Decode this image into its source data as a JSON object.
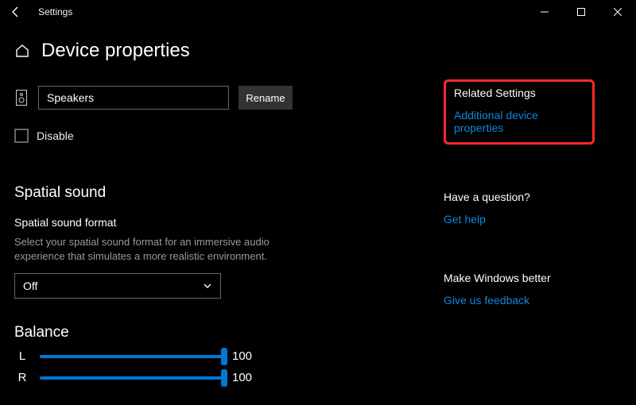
{
  "app": {
    "title": "Settings"
  },
  "page": {
    "title": "Device properties"
  },
  "device": {
    "name_value": "Speakers",
    "rename_label": "Rename"
  },
  "disable": {
    "label": "Disable"
  },
  "spatial": {
    "section": "Spatial sound",
    "format_label": "Spatial sound format",
    "help": "Select your spatial sound format for an immersive audio experience that simulates a more realistic environment.",
    "dropdown_value": "Off"
  },
  "balance": {
    "section": "Balance",
    "left": {
      "label": "L",
      "value": "100"
    },
    "right": {
      "label": "R",
      "value": "100"
    }
  },
  "sidebar": {
    "related": {
      "heading": "Related Settings",
      "link": "Additional device properties"
    },
    "question": {
      "heading": "Have a question?",
      "link": "Get help"
    },
    "feedback": {
      "heading": "Make Windows better",
      "link": "Give us feedback"
    }
  }
}
